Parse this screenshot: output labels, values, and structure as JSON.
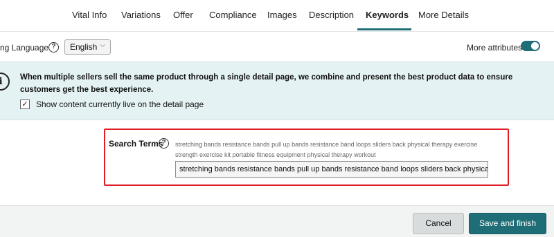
{
  "tabs": [
    {
      "label": "Vital Info"
    },
    {
      "label": "Variations"
    },
    {
      "label": "Offer"
    },
    {
      "label": "Compliance"
    },
    {
      "label": "Images"
    },
    {
      "label": "Description"
    },
    {
      "label": "Keywords",
      "active": true
    },
    {
      "label": "More Details"
    }
  ],
  "language": {
    "label": "ng Language",
    "help_icon": "?",
    "selected": "English",
    "chevron": "⌵"
  },
  "more_attributes": {
    "label": "More attributes",
    "enabled": true
  },
  "banner": {
    "icon": "i",
    "text": "When multiple sellers sell the same product through a single detail page, we combine and present the best product data to ensure customers get the best experience.",
    "checkbox_checked": true,
    "checkbox_mark": "✓",
    "checkbox_label": "Show content currently live on the detail page"
  },
  "search_terms": {
    "label": "Search Terms",
    "help_icon": "?",
    "current_live": "stretching bands resistance bands pull up bands resistance band loops sliders back physical therapy exercise strength exercise kit portable fitness equipment physical therapy workout",
    "input_value": "stretching bands resistance bands pull up bands resistance band loops sliders back physical therapy"
  },
  "footer": {
    "cancel_label": "Cancel",
    "save_label": "Save and finish"
  },
  "colors": {
    "accent": "#1f6e77",
    "banner_bg": "#e5f2f3",
    "highlight": "#e11d26"
  }
}
